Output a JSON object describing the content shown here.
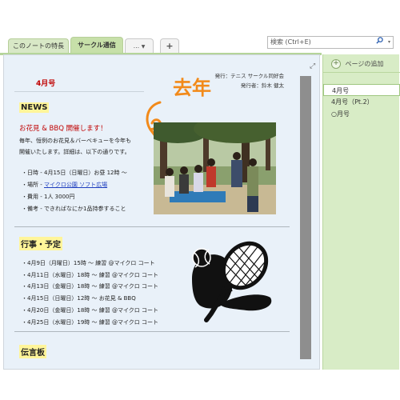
{
  "tabs": {
    "features": "このノートの特長",
    "circle": "サークル通信",
    "more": "...",
    "more_caret": "▼",
    "add": "+"
  },
  "search": {
    "placeholder": "検索 (Ctrl+E)",
    "icon": "search-icon",
    "caret": "▾"
  },
  "page": {
    "expand_icon": "⤢",
    "issue_heading": "4月号",
    "publisher_line1": "発行：テニス サークル同好会",
    "publisher_line2": "発行者：鈴木 健太",
    "handwriting": "去年",
    "news": {
      "title": "NEWS",
      "headline": "お花見 & BBQ 開催します！",
      "body_line1": "毎年、恒例のお花見＆バーベキューを今年も",
      "body_line2": "開催いたします。詳細は、以下の通りです。",
      "details": [
        {
          "prefix": "・日時 - ",
          "text": "4月15日（日曜日）お昼 12時 ～"
        },
        {
          "prefix": "・場所 - ",
          "text": "マイクロ公園 ソフト広場"
        },
        {
          "prefix": "・費用 - ",
          "text": "1人 3000円"
        },
        {
          "prefix": "・備考 - ",
          "text": "できればなにか1品持参すること"
        }
      ]
    },
    "events": {
      "title": "行事・予定",
      "items": [
        "・4月9日（月曜日）15時 ～ 練習 @マイクロ コート",
        "・4月11日（水曜日）18時 ～ 練習 @マイクロ コート",
        "・4月13日（金曜日）18時 ～ 練習 @マイクロ コート",
        "・4月15日（日曜日）12時 ～ お花見 & BBQ",
        "・4月20日（金曜日）18時 ～ 練習 @マイクロ コート",
        "・4月25日（水曜日）19時 ～ 練習 @マイクロ コート"
      ]
    },
    "board": {
      "title": "伝言板"
    }
  },
  "pages_panel": {
    "add_label": "ページの追加",
    "items": [
      "4月号",
      "4月号（Pt.2）",
      "○月号"
    ],
    "selected_index": 0
  },
  "colors": {
    "accent_green": "#c7e0a9",
    "headline_red": "#c00000",
    "highlight_yellow": "#fff59a",
    "handwriting_orange": "#f28a1a",
    "link_blue": "#1f3fbf"
  }
}
